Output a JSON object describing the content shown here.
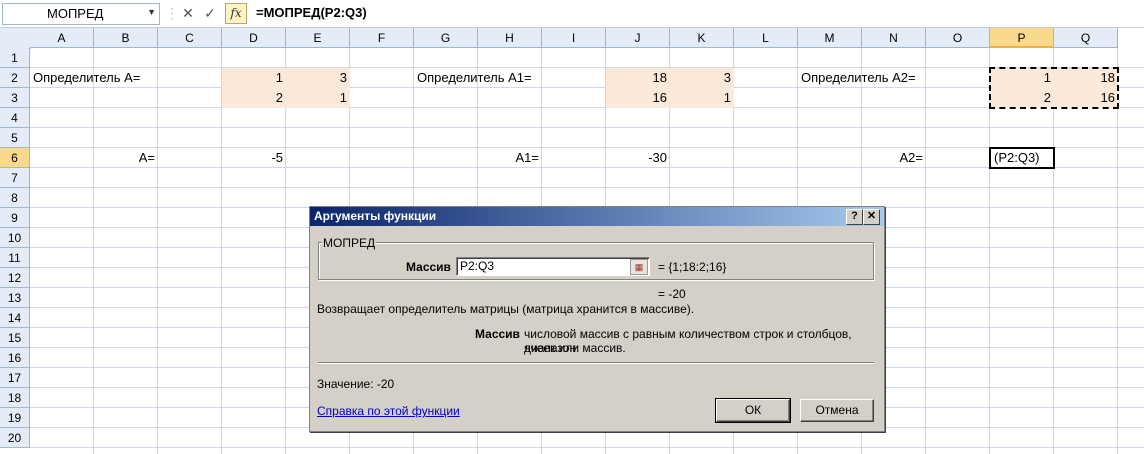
{
  "formula_bar": {
    "name_box": "МОПРЕД",
    "cancel_glyph": "✕",
    "enter_glyph": "✓",
    "fx_label": "fx",
    "formula": "=МОПРЕД(P2:Q3)"
  },
  "columns": [
    "A",
    "B",
    "C",
    "D",
    "E",
    "F",
    "G",
    "H",
    "I",
    "J",
    "K",
    "L",
    "M",
    "N",
    "O",
    "P",
    "Q"
  ],
  "selected_column": "P",
  "rows": [
    "1",
    "2",
    "3",
    "4",
    "5",
    "6",
    "7",
    "8",
    "9",
    "10",
    "11",
    "12",
    "13",
    "14",
    "15",
    "16",
    "17",
    "18",
    "19",
    "20"
  ],
  "selected_row": "6",
  "cells": {
    "A2": "Определитель  A=",
    "D2": "1",
    "E2": "3",
    "D3": "2",
    "E3": "1",
    "G2": "Определитель A1=",
    "J2": "18",
    "K2": "3",
    "J3": "16",
    "K3": "1",
    "M2": "Определитель A2=",
    "P2": "1",
    "Q2": "18",
    "P3": "2",
    "Q3": "16",
    "B6": "A=",
    "D6": "-5",
    "H6": "A1=",
    "J6": "-30",
    "N6": "A2=",
    "P6": "(P2:Q3)"
  },
  "colors": {
    "fill": "#fde9d9",
    "title_start": "#0a246a",
    "title_end": "#a6caf0",
    "dialog_bg": "#d4d0c8"
  },
  "dialog": {
    "title": "Аргументы функции",
    "help_glyph": "?",
    "close_glyph": "✕",
    "group_label": "МОПРЕД",
    "arg_name": "Массив",
    "arg_value": "P2:Q3",
    "arg_result": "=  {1;18:2;16}",
    "result": "=  -20",
    "description": "Возвращает определитель матрицы (матрица хранится в массиве).",
    "arg_desc_name": "Массив",
    "arg_desc_line1": "числовой массив с равным количеством строк и столбцов, диапазон",
    "arg_desc_line2": "ячеек или массив.",
    "value_text": "Значение:   -20",
    "help_link": "Справка по этой функции",
    "ok": "ОК",
    "cancel": "Отмена"
  }
}
